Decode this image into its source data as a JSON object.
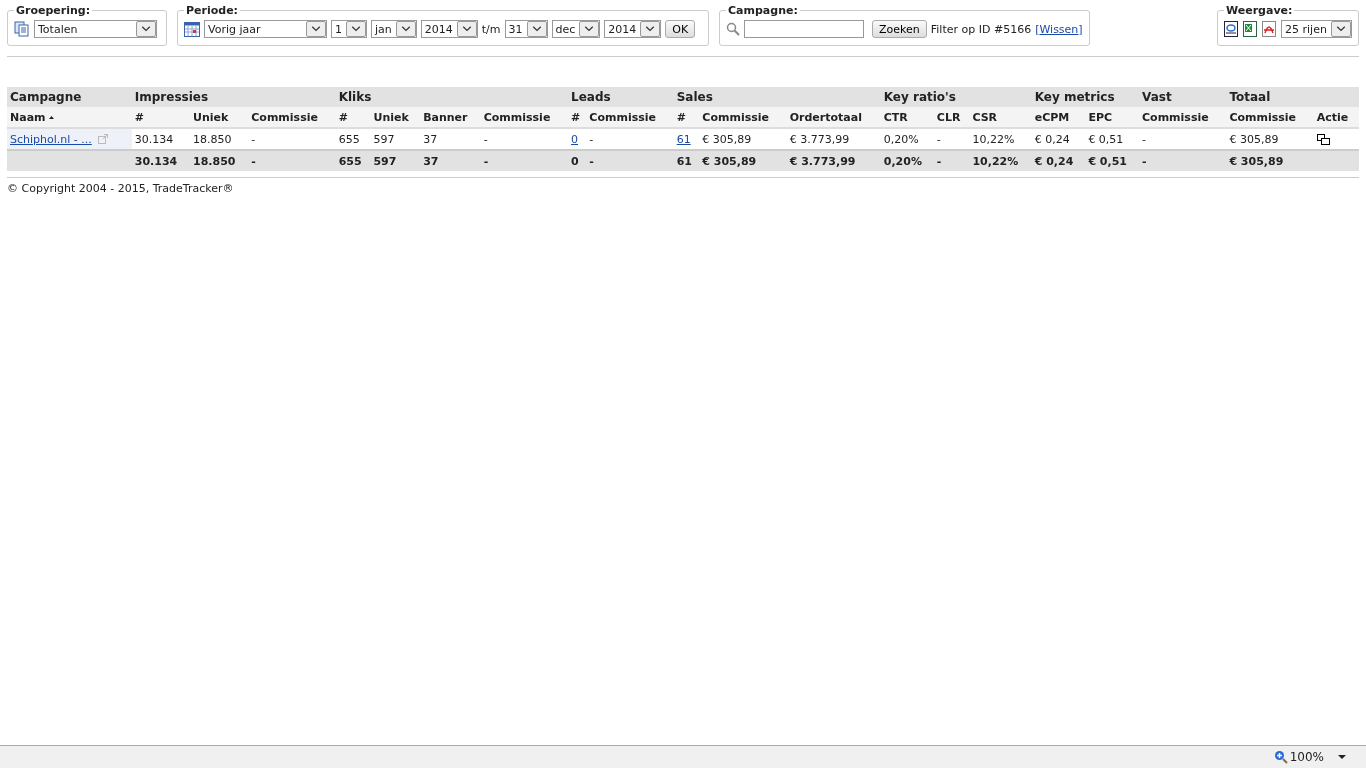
{
  "filters": {
    "grouping": {
      "legend": "Groepering:",
      "select": "Totalen"
    },
    "period": {
      "legend": "Periode:",
      "preset": "Vorig jaar",
      "from": [
        "1",
        "jan",
        "2014"
      ],
      "separator": "t/m",
      "to": [
        "31",
        "dec",
        "2014"
      ],
      "ok": "OK"
    },
    "campaign": {
      "legend": "Campagne:",
      "button": "Zoeken",
      "filter_text": "Filter op ID #5166",
      "bracket_open": "[",
      "clear_link": "Wissen",
      "bracket_close": "]"
    },
    "view": {
      "legend": "Weergave:",
      "rows": "25 rijen"
    }
  },
  "table": {
    "groups": [
      "Campagne",
      "Impressies",
      "Kliks",
      "Leads",
      "Sales",
      "Key ratio's",
      "Key metrics",
      "Vast",
      "Totaal"
    ],
    "columns": [
      {
        "label": "Naam",
        "sorted": true
      },
      {
        "label": "#"
      },
      {
        "label": "Uniek"
      },
      {
        "label": "Commissie"
      },
      {
        "label": "#"
      },
      {
        "label": "Uniek"
      },
      {
        "label": "Banner"
      },
      {
        "label": "Commissie"
      },
      {
        "label": "#"
      },
      {
        "label": "Commissie"
      },
      {
        "label": "#"
      },
      {
        "label": "Commissie"
      },
      {
        "label": "Ordertotaal"
      },
      {
        "label": "CTR"
      },
      {
        "label": "CLR"
      },
      {
        "label": "CSR"
      },
      {
        "label": "eCPM"
      },
      {
        "label": "EPC"
      },
      {
        "label": "Commissie"
      },
      {
        "label": "Commissie"
      },
      {
        "label": "Actie"
      }
    ],
    "rows": [
      [
        {
          "kind": "name",
          "text": "Schiphol.nl - ..."
        },
        {
          "kind": "text",
          "text": "30.134"
        },
        {
          "kind": "text",
          "text": "18.850"
        },
        {
          "kind": "text",
          "text": "-"
        },
        {
          "kind": "text",
          "text": "655"
        },
        {
          "kind": "text",
          "text": "597"
        },
        {
          "kind": "text",
          "text": "37"
        },
        {
          "kind": "text",
          "text": "-"
        },
        {
          "kind": "link",
          "text": "0"
        },
        {
          "kind": "text",
          "text": "-"
        },
        {
          "kind": "link",
          "text": "61"
        },
        {
          "kind": "text",
          "text": "€ 305,89"
        },
        {
          "kind": "text",
          "text": "€ 3.773,99"
        },
        {
          "kind": "text",
          "text": "0,20%"
        },
        {
          "kind": "text",
          "text": "-"
        },
        {
          "kind": "text",
          "text": "10,22%"
        },
        {
          "kind": "text",
          "text": "€ 0,24"
        },
        {
          "kind": "text",
          "text": "€ 0,51"
        },
        {
          "kind": "text",
          "text": "-"
        },
        {
          "kind": "text",
          "text": "€ 305,89"
        },
        {
          "kind": "action"
        }
      ]
    ],
    "totals": [
      "30.134",
      "18.850",
      "-",
      "655",
      "597",
      "37",
      "-",
      "0",
      "-",
      "61",
      "€ 305,89",
      "€ 3.773,99",
      "0,20%",
      "-",
      "10,22%",
      "€ 0,24",
      "€ 0,51",
      "-",
      "€ 305,89"
    ]
  },
  "footer": "© Copyright 2004 - 2015, TradeTracker®",
  "status_bar": {
    "zoom": "100%"
  }
}
